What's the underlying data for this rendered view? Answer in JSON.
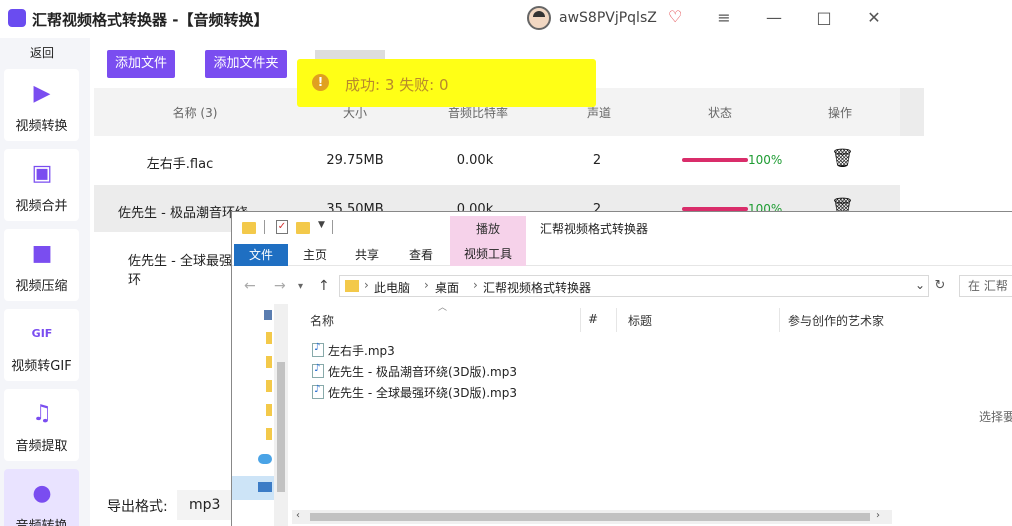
{
  "app": {
    "title": "汇帮视频格式转换器 -【音频转换】",
    "username": "awS8PVjPqlsZ",
    "vip_icon": "vip-heart-icon",
    "controls": {
      "menu": "≡",
      "minimize": "—",
      "maximize": "□",
      "close": "✕"
    }
  },
  "sidebar": {
    "back_label": "返回",
    "items": [
      {
        "label": "视频转换",
        "icon": "video-convert-icon"
      },
      {
        "label": "视频合并",
        "icon": "video-merge-icon"
      },
      {
        "label": "视频压缩",
        "icon": "video-compress-icon"
      },
      {
        "label": "视频转GIF",
        "icon": "gif-icon"
      },
      {
        "label": "音频提取",
        "icon": "music-note-icon"
      },
      {
        "label": "音频转换",
        "icon": "microphone-icon"
      }
    ],
    "accent": "#7a4df0"
  },
  "toolbar": {
    "add_file_label": "添加文件",
    "add_folder_label": "添加文件夹"
  },
  "table": {
    "headers": [
      "名称 (3)",
      "大小",
      "音频比特率",
      "声道",
      "状态",
      "操作"
    ],
    "rows": [
      {
        "name": "左右手.flac",
        "size": "29.75MB",
        "bitrate": "0.00k",
        "channels": "2",
        "progress": 1.0,
        "status": "100%"
      },
      {
        "name": "佐先生 - 极品潮音环绕",
        "size": "35.50MB",
        "bitrate": "0.00k",
        "channels": "2",
        "progress": 1.0,
        "status": "100%"
      },
      {
        "name": "佐先生 - 全球最强环",
        "size": "",
        "bitrate": "",
        "channels": "",
        "progress": null,
        "status": ""
      }
    ]
  },
  "toast": {
    "text": "成功: 3    失败: 0",
    "color": "#ffff16"
  },
  "export": {
    "label": "导出格式:",
    "value": "mp3"
  },
  "explorer": {
    "title": "汇帮视频格式转换器",
    "context_tab": "播放",
    "context_tools": "视频工具",
    "ribbon_tabs": [
      "文件",
      "主页",
      "共享",
      "查看"
    ],
    "breadcrumb": [
      "此电脑",
      "桌面",
      "汇帮视频格式转换器"
    ],
    "search_placeholder": "在 汇帮",
    "columns": [
      "名称",
      "#",
      "标题",
      "参与创作的艺术家"
    ],
    "files": [
      "左右手.mp3",
      "佐先生 - 极品潮音环绕(3D版).mp3",
      "佐先生 - 全球最强环绕(3D版).mp3"
    ],
    "preview_hint": "选择要"
  }
}
